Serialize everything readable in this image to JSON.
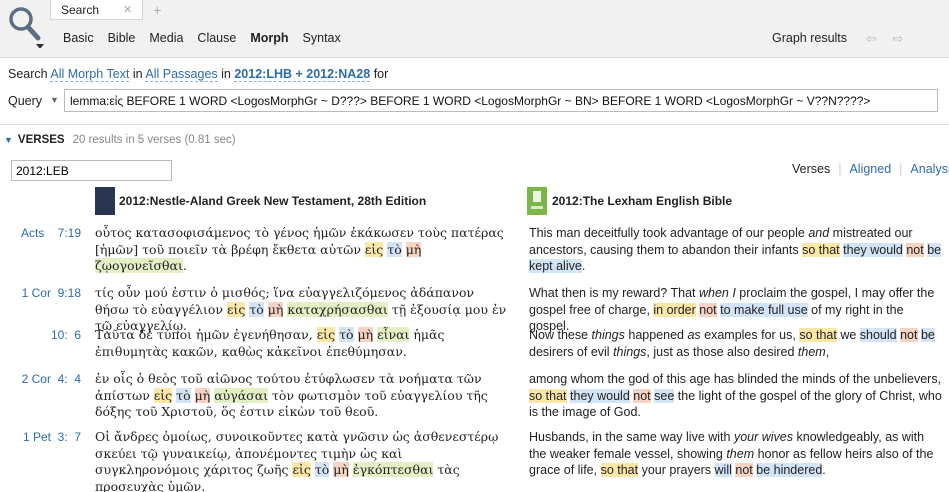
{
  "toolbar": {
    "tabs": [
      {
        "label": "Search",
        "close": "✕"
      }
    ],
    "add_tab": "+",
    "modes": [
      "Basic",
      "Bible",
      "Media",
      "Clause",
      "Morph",
      "Syntax"
    ],
    "active_mode": "Morph",
    "graph_results": "Graph results",
    "nav_arrows": "⇦ ⇨"
  },
  "search": {
    "prefix": "Search",
    "scope": "All Morph Text",
    "in_word": "in",
    "passages": "All Passages",
    "in_word2": "in",
    "resources": "2012:LHB + 2012:NA28",
    "for_word": "for",
    "query_label": "Query",
    "query_caret": "▼",
    "query_value": "lemma:εἰς BEFORE 1 WORD <LogosMorphGr ~ D???> BEFORE 1 WORD <LogosMorphGr ~ BN> BEFORE 1 WORD <LogosMorphGr ~ V??N????>"
  },
  "verses": {
    "triangle": "▼",
    "title": "VERSES",
    "count": "20 results in 5 verses (0.81 sec)",
    "version_value": "2012:LEB",
    "views": [
      "Verses",
      "Aligned",
      "Analysis"
    ]
  },
  "columns": {
    "greek": "2012:Nestle-Aland Greek New Testament, 28th Edition",
    "english": "2012:The Lexham English Bible"
  },
  "rows": [
    {
      "ref": "Acts    7:19",
      "greek": [
        [
          "οὗτος κατασοφισάμενος τὸ γένος ἡμῶν ἐκάκωσεν τοὺς πατέρας [ἡμῶν] τοῦ ποιεῖν τὰ βρέφη ἔκθετα αὐτῶν ",
          ""
        ],
        [
          "εἰς",
          "hy"
        ],
        [
          " ",
          ""
        ],
        [
          "τὸ",
          "hb"
        ],
        [
          " ",
          ""
        ],
        [
          "μὴ",
          "hr"
        ],
        [
          " ",
          ""
        ],
        [
          "ζῳογονεῖσθαι",
          "hg"
        ],
        [
          ".",
          ""
        ]
      ],
      "english": [
        [
          "This man deceitfully took advantage of our people ",
          ""
        ],
        [
          "and",
          "it"
        ],
        [
          " mistreated our ancestors, causing them to abandon their infants ",
          ""
        ],
        [
          "so that",
          "hy"
        ],
        [
          " ",
          ""
        ],
        [
          "they would",
          "hb"
        ],
        [
          " ",
          ""
        ],
        [
          "not",
          "hr"
        ],
        [
          " ",
          ""
        ],
        [
          "be kept alive",
          "hb"
        ],
        [
          ".",
          ""
        ]
      ]
    },
    {
      "ref": "1 Cor  9:18",
      "greek": [
        [
          "τίς οὖν μού ἐστιν ὁ μισθός; ἵνα εὐαγγελιζόμενος ἀδάπανον θήσω τὸ εὐαγγέλιον ",
          ""
        ],
        [
          "εἰς",
          "hy"
        ],
        [
          " ",
          ""
        ],
        [
          "τὸ",
          "hb"
        ],
        [
          " ",
          ""
        ],
        [
          "μὴ",
          "hr"
        ],
        [
          " ",
          ""
        ],
        [
          "καταχρήσασθαι",
          "hg"
        ],
        [
          " τῇ ἐξουσίᾳ μου ἐν τῷ εὐαγγελίῳ.",
          ""
        ]
      ],
      "english": [
        [
          "What then is my reward? That ",
          ""
        ],
        [
          "when I",
          "it"
        ],
        [
          " proclaim the gospel, I may offer the gospel free of charge, ",
          ""
        ],
        [
          "in order",
          "hy"
        ],
        [
          " ",
          ""
        ],
        [
          "not",
          "hr"
        ],
        [
          " ",
          ""
        ],
        [
          "to make full use",
          "hb"
        ],
        [
          " of my right in the gospel.",
          ""
        ]
      ]
    },
    {
      "ref": "10:  6",
      "greek": [
        [
          "Ταῦτα δὲ τύποι ἡμῶν ἐγενήθησαν, ",
          ""
        ],
        [
          "εἰς",
          "hy"
        ],
        [
          " ",
          ""
        ],
        [
          "τὸ",
          "hb"
        ],
        [
          " ",
          ""
        ],
        [
          "μὴ",
          "hr"
        ],
        [
          " ",
          ""
        ],
        [
          "εἶναι",
          "hg"
        ],
        [
          " ἡμᾶς ἐπιθυμητὰς κακῶν, καθὼς κἀκεῖνοι ἐπεθύμησαν.",
          ""
        ]
      ],
      "english": [
        [
          "Now these ",
          ""
        ],
        [
          "things",
          "it"
        ],
        [
          " happened ",
          ""
        ],
        [
          "as",
          "it"
        ],
        [
          " examples for us, ",
          ""
        ],
        [
          "so that",
          "hy"
        ],
        [
          " we ",
          ""
        ],
        [
          "should",
          "hb"
        ],
        [
          " ",
          ""
        ],
        [
          "not",
          "hr"
        ],
        [
          " ",
          ""
        ],
        [
          "be",
          "hb"
        ],
        [
          " desirers of evil ",
          ""
        ],
        [
          "things",
          "it"
        ],
        [
          ", just as those also desired ",
          ""
        ],
        [
          "them",
          "it"
        ],
        [
          ",",
          ""
        ]
      ]
    },
    {
      "ref": "2 Cor  4:  4",
      "greek": [
        [
          "ἐν οἷς ὁ θεὸς τοῦ αἰῶνος τούτου ἐτύφλωσεν τὰ νοήματα τῶν ἀπίστων ",
          ""
        ],
        [
          "εἰς",
          "hy"
        ],
        [
          " ",
          ""
        ],
        [
          "τὸ",
          "hb"
        ],
        [
          " ",
          ""
        ],
        [
          "μὴ",
          "hr"
        ],
        [
          " ",
          ""
        ],
        [
          "αὐγάσαι",
          "hg"
        ],
        [
          " τὸν φωτισμὸν τοῦ εὐαγγελίου τῆς δόξης τοῦ Χριστοῦ, ὅς ἐστιν εἰκὼν τοῦ θεοῦ.",
          ""
        ]
      ],
      "english": [
        [
          "among whom the god of this age has blinded the minds of the unbelievers, ",
          ""
        ],
        [
          "so that",
          "hy"
        ],
        [
          " ",
          ""
        ],
        [
          "they would",
          "hb"
        ],
        [
          " ",
          ""
        ],
        [
          "not",
          "hr"
        ],
        [
          " ",
          ""
        ],
        [
          "see",
          "hb"
        ],
        [
          " the light of the gospel of the glory of Christ, who is the image of God.",
          ""
        ]
      ]
    },
    {
      "ref": "1 Pet  3:  7",
      "greek": [
        [
          "Οἱ ἄνδρες ὁμοίως, συνοικοῦντες κατὰ γνῶσιν ὡς ἀσθενεστέρῳ σκεύει τῷ γυναικείῳ, ἀπονέμοντες τιμὴν ὡς καὶ συγκληρονόμοις χάριτος ζωῆς ",
          ""
        ],
        [
          "εἰς",
          "hy"
        ],
        [
          " ",
          ""
        ],
        [
          "τὸ",
          "hb"
        ],
        [
          " ",
          ""
        ],
        [
          "μὴ",
          "hr"
        ],
        [
          " ",
          ""
        ],
        [
          "ἐγκόπτεσθαι",
          "hg"
        ],
        [
          " τὰς προσευχὰς ὑμῶν.",
          ""
        ]
      ],
      "english": [
        [
          "Husbands, in the same way live with ",
          ""
        ],
        [
          "your wives",
          "it"
        ],
        [
          " knowledgeably, as with the weaker female vessel, showing ",
          ""
        ],
        [
          "them",
          "it"
        ],
        [
          " honor as fellow heirs also of the grace of life, ",
          ""
        ],
        [
          "so that",
          "hy"
        ],
        [
          " your prayers ",
          ""
        ],
        [
          "will",
          "hb"
        ],
        [
          " ",
          ""
        ],
        [
          "not",
          "hr"
        ],
        [
          " ",
          ""
        ],
        [
          "be hindered",
          "hb"
        ],
        [
          ".",
          ""
        ]
      ]
    }
  ],
  "colors": {
    "link": "#2d6ca8",
    "highlight_yellow": "#fde7a6",
    "highlight_blue": "#d3e4f6",
    "highlight_red": "#f7d3c3",
    "highlight_green": "#e3efc4"
  }
}
